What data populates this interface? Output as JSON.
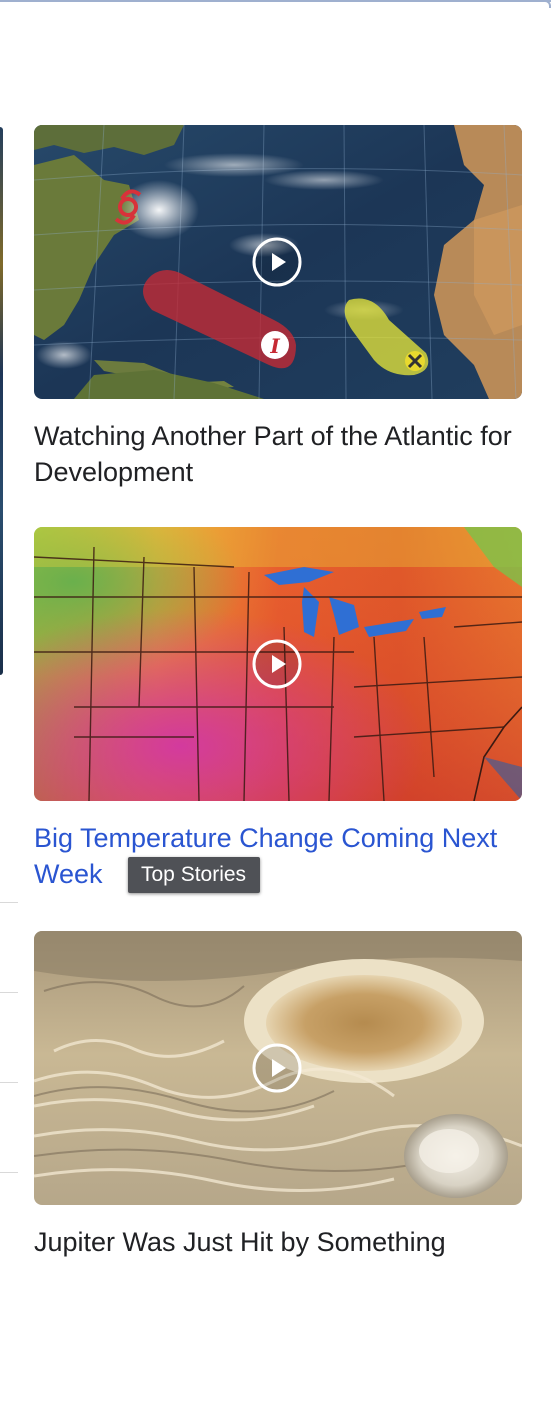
{
  "stories": [
    {
      "title": "Watching Another Part of the Atlantic for Development",
      "thumbnail": "atlantic-tropics-map",
      "media": "video"
    },
    {
      "title": "Big Temperature Change Coming Next Week",
      "thumbnail": "us-temperature-map",
      "media": "video",
      "state": "hovered"
    },
    {
      "title": "Jupiter Was Just Hit by Something",
      "thumbnail": "jupiter-great-red-spot",
      "media": "video"
    }
  ],
  "tooltip": {
    "text": "Top Stories"
  },
  "colors": {
    "headline": "#202124",
    "headline_hover": "#2a55d1",
    "tooltip_bg": "#4f5156"
  }
}
